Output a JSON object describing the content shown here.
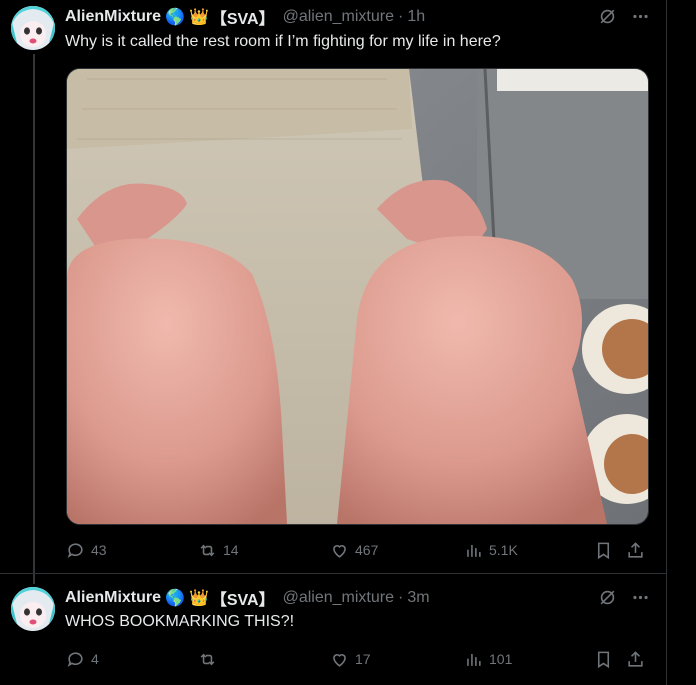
{
  "posts": [
    {
      "author": "AlienMixture",
      "badge": "【SVA】",
      "handle": "@alien_mixture",
      "separator": "·",
      "time": "1h",
      "text": "Why is it called the rest room if I’m fighting for my life in here?",
      "metrics": {
        "replies": "43",
        "reposts": "14",
        "likes": "467",
        "views": "5.1K"
      }
    },
    {
      "author": "AlienMixture",
      "badge": "【SVA】",
      "handle": "@alien_mixture",
      "separator": "·",
      "time": "3m",
      "text": "WHOS BOOKMARKING THIS?!",
      "metrics": {
        "replies": "4",
        "reposts": "",
        "likes": "17",
        "views": "101"
      }
    }
  ],
  "emojis": [
    "🌎",
    "👑"
  ],
  "colors": {
    "background": "#000000",
    "text": "#e7e9ea",
    "muted": "#71767b",
    "border": "#2f3336"
  }
}
